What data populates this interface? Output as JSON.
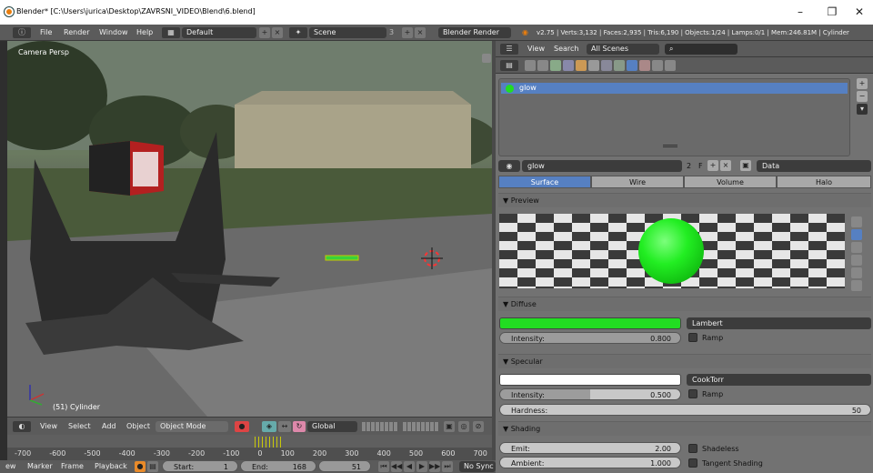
{
  "window": {
    "title": "Blender* [C:\\Users\\jurica\\Desktop\\ZAVRSNI_VIDEO\\Blend\\6.blend]",
    "min": "–",
    "max": "❐",
    "close": "✕"
  },
  "menu": {
    "items": [
      "File",
      "Render",
      "Window",
      "Help"
    ],
    "layout": "Default",
    "scene": "Scene",
    "scene_count": "3",
    "engine": "Blender Render",
    "stats": "v2.75 | Verts:3,132 | Faces:2,935 | Tris:6,190 | Objects:1/24 | Lamps:0/1 | Mem:246.81M | Cylinder"
  },
  "viewport": {
    "view_label": "Camera Persp",
    "object_label": "(51) Cylinder"
  },
  "viewport_header": {
    "view": "View",
    "select": "Select",
    "add": "Add",
    "object": "Object",
    "mode": "Object Mode",
    "orientation": "Global"
  },
  "timeline": {
    "ruler": [
      "-700",
      "-600",
      "-500",
      "-400",
      "-300",
      "-200",
      "-100",
      "0",
      "100",
      "200",
      "300",
      "400",
      "500",
      "600",
      "700"
    ],
    "view": "ew",
    "marker": "Marker",
    "frame": "Frame",
    "playback": "Playback",
    "start_label": "Start:",
    "start": "1",
    "end_label": "End:",
    "end": "168",
    "current": "51",
    "sync": "No Sync"
  },
  "outliner": {
    "view": "View",
    "search": "Search",
    "filter": "All Scenes",
    "item": "glow"
  },
  "material": {
    "name": "glow",
    "users": "2",
    "fake": "F",
    "data": "Data"
  },
  "tabs": [
    "Surface",
    "Wire",
    "Volume",
    "Halo"
  ],
  "sections": {
    "preview": "Preview",
    "diffuse": {
      "title": "Diffuse",
      "shader": "Lambert",
      "intensity_label": "Intensity:",
      "intensity": "0.800",
      "ramp": "Ramp",
      "color": "#22dd22"
    },
    "specular": {
      "title": "Specular",
      "shader": "CookTorr",
      "intensity_label": "Intensity:",
      "intensity": "0.500",
      "ramp": "Ramp",
      "hardness_label": "Hardness:",
      "hardness": "50",
      "color": "#ffffff"
    },
    "shading": {
      "title": "Shading",
      "emit_label": "Emit:",
      "emit": "2.00",
      "ambient_label": "Ambient:",
      "ambient": "1.000",
      "shadeless": "Shadeless",
      "tangent": "Tangent Shading"
    }
  },
  "colors": {
    "accent": "#5680c2",
    "glow": "#22dd22"
  }
}
